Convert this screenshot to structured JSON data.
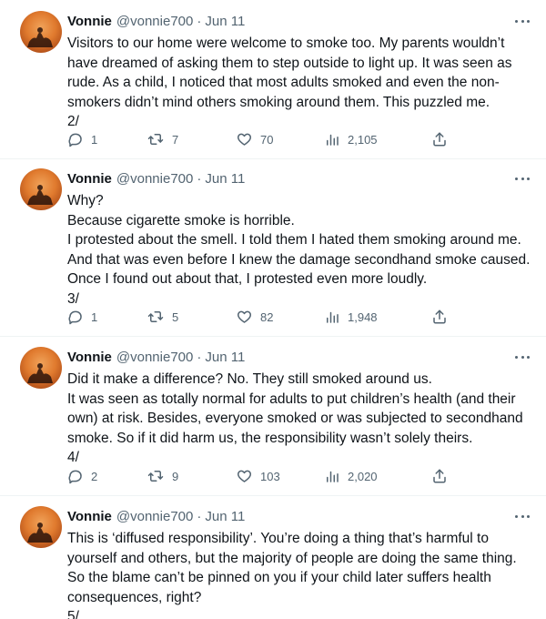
{
  "tweets": [
    {
      "name": "Vonnie",
      "handle": "@vonnie700",
      "separator": "·",
      "date": "Jun 11",
      "lines": [
        "Visitors to our home were welcome to smoke too. My parents wouldn’t",
        "have dreamed of asking them to step outside to light up. It was seen as",
        "rude. As a child, I noticed that most adults smoked and even the non-",
        "smokers didn’t mind others smoking around them. This puzzled me.",
        "2/"
      ],
      "replies": "1",
      "retweets": "7",
      "likes": "70",
      "views": "2,105"
    },
    {
      "name": "Vonnie",
      "handle": "@vonnie700",
      "separator": "·",
      "date": "Jun 11",
      "lines": [
        "Why?",
        "Because cigarette smoke is horrible.",
        "I protested about the smell. I told them I hated them smoking around me.",
        "And that was even before I knew the damage secondhand smoke caused.",
        "Once I found out about that, I protested even more loudly.",
        "3/"
      ],
      "replies": "1",
      "retweets": "5",
      "likes": "82",
      "views": "1,948"
    },
    {
      "name": "Vonnie",
      "handle": "@vonnie700",
      "separator": "·",
      "date": "Jun 11",
      "lines": [
        "Did it make a difference? No. They still smoked around us.",
        "It was seen as totally normal for adults to put children’s health (and their",
        "own) at risk. Besides, everyone smoked or was subjected to secondhand",
        "smoke. So if it did harm us, the responsibility wasn’t solely theirs.",
        "4/"
      ],
      "replies": "2",
      "retweets": "9",
      "likes": "103",
      "views": "2,020"
    },
    {
      "name": "Vonnie",
      "handle": "@vonnie700",
      "separator": "·",
      "date": "Jun 11",
      "lines": [
        "This is ‘diffused responsibility’. You’re doing a thing that’s harmful to",
        "yourself and others, but the majority of people are doing the same thing.",
        "So the blame can’t be pinned on you if your child later suffers health",
        "consequences, right?",
        "5/"
      ]
    }
  ],
  "icons": {
    "reply": "reply-icon",
    "retweet": "retweet-icon",
    "like": "heart-icon",
    "views": "views-icon",
    "share": "share-icon",
    "more": "more-icon"
  },
  "colors": {
    "text": "#0f1419",
    "secondary": "#536471",
    "divider": "#eff3f4"
  }
}
